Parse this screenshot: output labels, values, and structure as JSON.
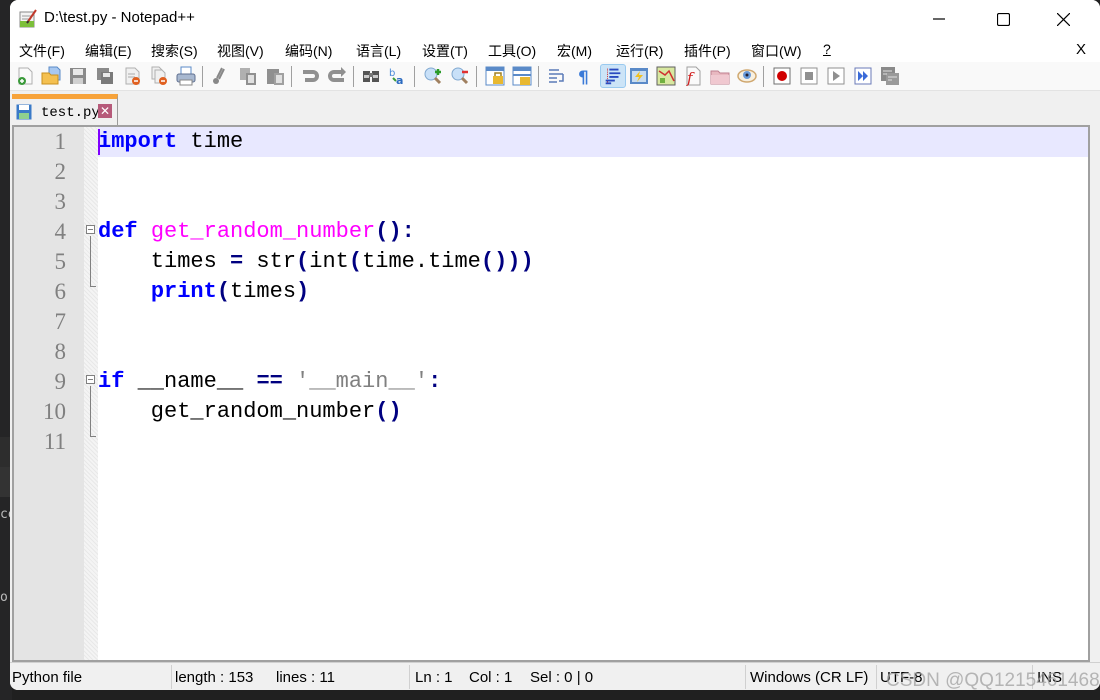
{
  "window": {
    "title": "D:\\test.py - Notepad++",
    "minimize_glyph": "—",
    "maximize_glyph": "☐",
    "close_glyph": "✕"
  },
  "menu": {
    "items": [
      {
        "label": "文件(F)"
      },
      {
        "label": "编辑(E)"
      },
      {
        "label": "搜索(S)"
      },
      {
        "label": "视图(V)"
      },
      {
        "label": "编码(N)"
      },
      {
        "label": "语言(L)"
      },
      {
        "label": "设置(T)"
      },
      {
        "label": "工具(O)"
      },
      {
        "label": "宏(M)"
      },
      {
        "label": "运行(R)"
      },
      {
        "label": "插件(P)"
      },
      {
        "label": "窗口(W)"
      },
      {
        "label": "?"
      }
    ],
    "close_doc": "X"
  },
  "toolbar": {
    "icons": [
      "new-file-icon",
      "open-file-icon",
      "save-icon",
      "save-all-icon",
      "close-icon",
      "close-all-icon",
      "print-icon",
      "cut-icon",
      "copy-icon",
      "paste-icon",
      "undo-icon",
      "redo-icon",
      "find-icon",
      "replace-icon",
      "zoom-in-icon",
      "zoom-out-icon",
      "sync-vertical-icon",
      "sync-horizontal-icon",
      "word-wrap-icon",
      "show-all-chars-icon",
      "indent-guide-icon",
      "udl-icon",
      "document-map-icon",
      "function-list-icon",
      "folder-workspace-icon",
      "monitoring-icon",
      "macro-record-icon",
      "macro-stop-icon",
      "macro-play-icon",
      "macro-run-multiple-icon",
      "macro-save-icon"
    ]
  },
  "tabs": [
    {
      "label": "test.py",
      "active": true
    }
  ],
  "editor": {
    "line_numbers": [
      "1",
      "2",
      "3",
      "4",
      "5",
      "6",
      "7",
      "8",
      "9",
      "10",
      "11"
    ],
    "lines": [
      [
        {
          "t": "import",
          "c": "kw"
        },
        {
          "t": " time",
          "c": ""
        }
      ],
      [],
      [],
      [
        {
          "t": "def",
          "c": "kw"
        },
        {
          "t": " ",
          "c": ""
        },
        {
          "t": "get_random_number",
          "c": "fn"
        },
        {
          "t": "():",
          "c": "op"
        }
      ],
      [
        {
          "t": "    times ",
          "c": ""
        },
        {
          "t": "=",
          "c": "op"
        },
        {
          "t": " str",
          "c": ""
        },
        {
          "t": "(",
          "c": "op"
        },
        {
          "t": "int",
          "c": ""
        },
        {
          "t": "(",
          "c": "op"
        },
        {
          "t": "time.time",
          "c": ""
        },
        {
          "t": "()))",
          "c": "op"
        }
      ],
      [
        {
          "t": "    ",
          "c": ""
        },
        {
          "t": "print",
          "c": "kw"
        },
        {
          "t": "(",
          "c": "op"
        },
        {
          "t": "times",
          "c": ""
        },
        {
          "t": ")",
          "c": "op"
        }
      ],
      [],
      [],
      [
        {
          "t": "if",
          "c": "kw"
        },
        {
          "t": " __name__ ",
          "c": ""
        },
        {
          "t": "==",
          "c": "op"
        },
        {
          "t": " ",
          "c": ""
        },
        {
          "t": "'__main__'",
          "c": "str"
        },
        {
          "t": ":",
          "c": "op"
        }
      ],
      [
        {
          "t": "    get_random_number",
          "c": ""
        },
        {
          "t": "()",
          "c": "op"
        }
      ],
      []
    ],
    "current_line": 1
  },
  "status": {
    "language": "Python file",
    "length": "length : 153",
    "lines": "lines : 11",
    "ln": "Ln : 1",
    "col": "Col : 1",
    "sel": "Sel : 0 | 0",
    "eol": "Windows (CR LF)",
    "encoding": "UTF-8",
    "mode": "INS"
  },
  "watermark": "CSDN @QQ1215461468",
  "background": {
    "glyph1": "ce",
    "glyph2": "o"
  }
}
